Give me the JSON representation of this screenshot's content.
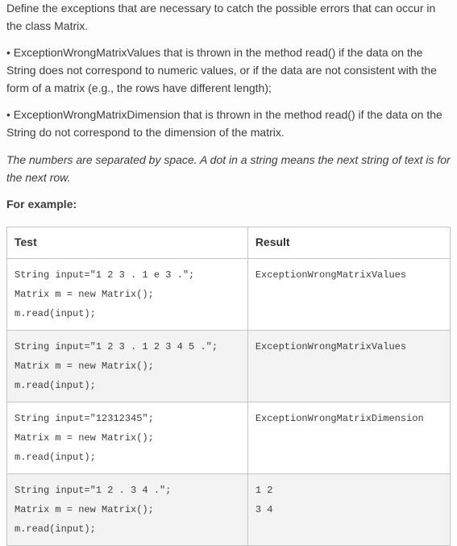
{
  "intro": "Define the exceptions that are necessary to catch the possible errors that can occur in the class Matrix.",
  "bullets": [
    "• ExceptionWrongMatrixValues that is thrown in the method read() if the data on the String does not correspond to numeric values, or if the data are not consistent with the form of a matrix (e.g., the rows have different length);",
    "• ExceptionWrongMatrixDimension that is thrown in the method read() if the data on the String do not correspond to the dimension of the matrix."
  ],
  "italic_note": "The numbers are separated by space. A dot in a string means the next string of text is for the next row.",
  "example_label": "For example:",
  "table": {
    "headers": [
      "Test",
      "Result"
    ],
    "rows": [
      {
        "test": "String input=\"1 2 3 . 1 e 3 .\";\nMatrix m = new Matrix();\nm.read(input);",
        "result": "ExceptionWrongMatrixValues"
      },
      {
        "test": "String input=\"1 2 3 . 1 2 3 4 5 .\";\nMatrix m = new Matrix();\nm.read(input);",
        "result": "ExceptionWrongMatrixValues"
      },
      {
        "test": "String input=\"12312345\";\nMatrix m = new Matrix();\nm.read(input);",
        "result": "ExceptionWrongMatrixDimension"
      },
      {
        "test": "String input=\"1 2 . 3 4 .\";\nMatrix m = new Matrix();\nm.read(input);",
        "result": "1 2\n3 4"
      }
    ]
  }
}
